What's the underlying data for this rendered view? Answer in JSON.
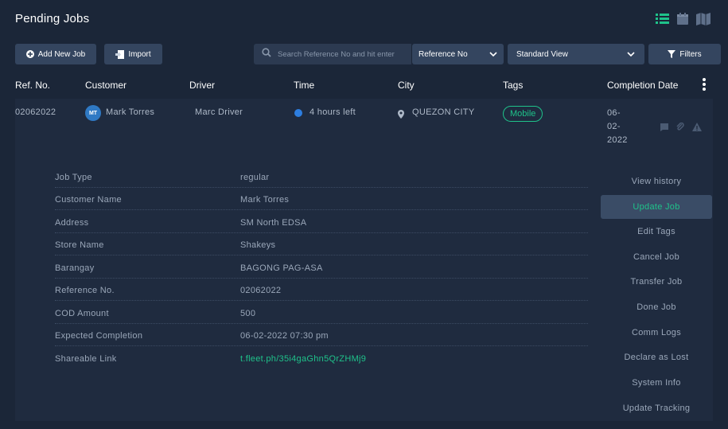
{
  "page": {
    "title": "Pending Jobs"
  },
  "view_icons": [
    "list-view-icon",
    "calendar-view-icon",
    "map-view-icon"
  ],
  "toolbar": {
    "add_job_label": "Add New Job",
    "import_label": "Import",
    "search_placeholder": "Search Reference No and hit enter",
    "search_field_select": "Reference No",
    "view_select": "Standard View",
    "filters_label": "Filters"
  },
  "table": {
    "headers": {
      "ref": "Ref. No.",
      "customer": "Customer",
      "driver": "Driver",
      "time": "Time",
      "city": "City",
      "tags": "Tags",
      "completion": "Completion Date"
    },
    "row": {
      "ref": "02062022",
      "customer_initials": "MT",
      "customer": "Mark Torres",
      "driver": "Marc Driver",
      "time": "4 hours left",
      "city": "QUEZON CITY",
      "tag": "Mobile",
      "date_parts": [
        "06-",
        "02-",
        "2022"
      ]
    }
  },
  "details": [
    {
      "label": "Job Type",
      "value": "regular"
    },
    {
      "label": "Customer Name",
      "value": "Mark Torres"
    },
    {
      "label": "Address",
      "value": "SM North EDSA"
    },
    {
      "label": "Store Name",
      "value": "Shakeys"
    },
    {
      "label": "Barangay",
      "value": "BAGONG PAG-ASA"
    },
    {
      "label": "Reference No.",
      "value": "02062022"
    },
    {
      "label": "COD Amount",
      "value": "500"
    },
    {
      "label": "Expected Completion",
      "value": "06-02-2022 07:30 pm"
    },
    {
      "label": "Shareable Link",
      "value": "t.fleet.ph/35i4gaGhn5QrZHMj9"
    }
  ],
  "actions": [
    "View history",
    "Update Job",
    "Edit Tags",
    "Cancel Job",
    "Transfer Job",
    "Done Job",
    "Comm Logs",
    "Declare as Lost",
    "System Info",
    "Update Tracking"
  ],
  "colors": {
    "background": "#1b2638",
    "panel": "#1f2b3f",
    "accent_green": "#1fc28a",
    "status_blue": "#2d7ee0"
  }
}
